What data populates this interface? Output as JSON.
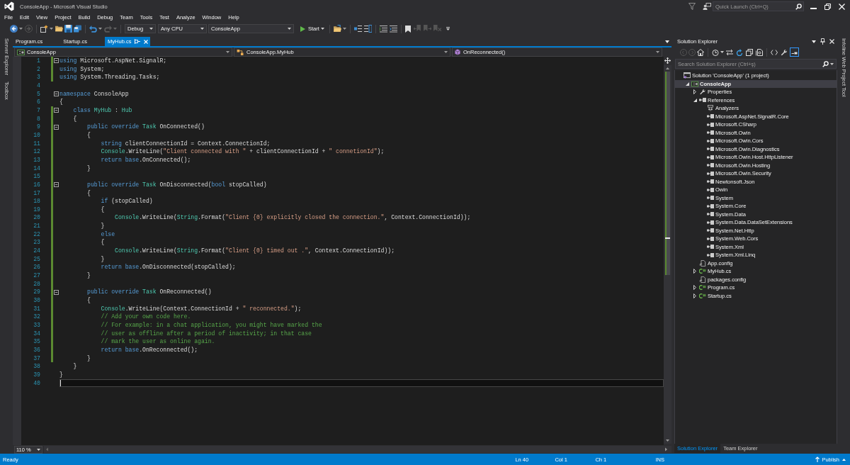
{
  "window": {
    "title": "ConsoleApp - Microsoft Visual Studio",
    "quick_launch": {
      "placeholder": "Quick Launch (Ctrl+Q)"
    }
  },
  "menu": [
    "File",
    "Edit",
    "View",
    "Project",
    "Build",
    "Debug",
    "Team",
    "Tools",
    "Test",
    "Analyze",
    "Window",
    "Help"
  ],
  "toolbar": {
    "configuration": "Debug",
    "platform": "Any CPU",
    "startup_project": "ConsoleApp",
    "run_button": "Start"
  },
  "left_tool_tabs": [
    "Server Explorer",
    "Toolbox"
  ],
  "document_tabs": [
    {
      "label": "Program.cs",
      "selected": false
    },
    {
      "label": "Startup.cs",
      "selected": false
    },
    {
      "label": "MyHub.cs",
      "selected": true
    }
  ],
  "navigation_bar": {
    "project": "ConsoleApp",
    "type": "ConsoleApp.MyHub",
    "member": "OnReconnected()"
  },
  "editor": {
    "lines": [
      {
        "number": "1",
        "changed": true,
        "collapsible": true,
        "current": false,
        "tokens": [
          {
            "kind": "keyword",
            "text": "using"
          },
          {
            "kind": "plain",
            "text": " Microsoft.AspNet.SignalR;"
          }
        ]
      },
      {
        "number": "2",
        "changed": true,
        "collapsible": false,
        "current": false,
        "tokens": [
          {
            "kind": "keyword",
            "text": "using"
          },
          {
            "kind": "plain",
            "text": " System;"
          }
        ]
      },
      {
        "number": "3",
        "changed": true,
        "collapsible": false,
        "current": false,
        "tokens": [
          {
            "kind": "keyword",
            "text": "using"
          },
          {
            "kind": "plain",
            "text": " System.Threading.Tasks;"
          }
        ]
      },
      {
        "number": "4",
        "changed": false,
        "collapsible": false,
        "current": false
      },
      {
        "number": "5",
        "changed": false,
        "collapsible": true,
        "current": false,
        "tokens": [
          {
            "kind": "keyword",
            "text": "namespace"
          },
          {
            "kind": "plain",
            "text": " ConsoleApp"
          }
        ]
      },
      {
        "number": "6",
        "changed": false,
        "collapsible": false,
        "current": false,
        "tokens": [
          {
            "kind": "plain",
            "text": "{"
          }
        ]
      },
      {
        "number": "7",
        "changed": true,
        "collapsible": true,
        "current": false,
        "tokens": [
          {
            "kind": "keyword",
            "text": "    class"
          },
          {
            "kind": "type",
            "text": " MyHub"
          },
          {
            "kind": "plain",
            "text": " : "
          },
          {
            "kind": "type",
            "text": "Hub"
          }
        ]
      },
      {
        "number": "8",
        "changed": true,
        "collapsible": false,
        "current": false,
        "tokens": [
          {
            "kind": "plain",
            "text": "    {"
          }
        ]
      },
      {
        "number": "9",
        "changed": true,
        "collapsible": true,
        "current": false,
        "tokens": [
          {
            "kind": "keyword",
            "text": "        public"
          },
          {
            "kind": "keyword",
            "text": " override"
          },
          {
            "kind": "type",
            "text": " Task"
          },
          {
            "kind": "plain",
            "text": " OnConnected()"
          }
        ]
      },
      {
        "number": "10",
        "changed": true,
        "collapsible": false,
        "current": false,
        "tokens": [
          {
            "kind": "plain",
            "text": "        {"
          }
        ]
      },
      {
        "number": "11",
        "changed": true,
        "collapsible": false,
        "current": false,
        "tokens": [
          {
            "kind": "keyword",
            "text": "            string"
          },
          {
            "kind": "plain",
            "text": " clientConnectionId = Context.ConnectionId;"
          }
        ]
      },
      {
        "number": "12",
        "changed": true,
        "collapsible": false,
        "current": false,
        "tokens": [
          {
            "kind": "type",
            "text": "            Console"
          },
          {
            "kind": "plain",
            "text": ".WriteLine("
          },
          {
            "kind": "string",
            "text": "\"Client connected with \""
          },
          {
            "kind": "plain",
            "text": " + clientConnectionId + "
          },
          {
            "kind": "string",
            "text": "\" connetionId\""
          },
          {
            "kind": "plain",
            "text": ");"
          }
        ]
      },
      {
        "number": "13",
        "changed": true,
        "collapsible": false,
        "current": false,
        "tokens": [
          {
            "kind": "keyword",
            "text": "            return"
          },
          {
            "kind": "keyword",
            "text": " base"
          },
          {
            "kind": "plain",
            "text": ".OnConnected();"
          }
        ]
      },
      {
        "number": "14",
        "changed": true,
        "collapsible": false,
        "current": false,
        "tokens": [
          {
            "kind": "plain",
            "text": "        }"
          }
        ]
      },
      {
        "number": "15",
        "changed": true,
        "collapsible": false,
        "current": false
      },
      {
        "number": "16",
        "changed": true,
        "collapsible": true,
        "current": false,
        "tokens": [
          {
            "kind": "keyword",
            "text": "        public"
          },
          {
            "kind": "keyword",
            "text": " override"
          },
          {
            "kind": "type",
            "text": " Task"
          },
          {
            "kind": "plain",
            "text": " OnDisconnected("
          },
          {
            "kind": "keyword",
            "text": "bool"
          },
          {
            "kind": "plain",
            "text": " stopCalled)"
          }
        ]
      },
      {
        "number": "17",
        "changed": true,
        "collapsible": false,
        "current": false,
        "tokens": [
          {
            "kind": "plain",
            "text": "        {"
          }
        ]
      },
      {
        "number": "18",
        "changed": true,
        "collapsible": false,
        "current": false,
        "tokens": [
          {
            "kind": "keyword",
            "text": "            if"
          },
          {
            "kind": "plain",
            "text": " (stopCalled)"
          }
        ]
      },
      {
        "number": "19",
        "changed": true,
        "collapsible": false,
        "current": false,
        "tokens": [
          {
            "kind": "plain",
            "text": "            {"
          }
        ]
      },
      {
        "number": "20",
        "changed": true,
        "collapsible": false,
        "current": false,
        "tokens": [
          {
            "kind": "type",
            "text": "                Console"
          },
          {
            "kind": "plain",
            "text": ".WriteLine("
          },
          {
            "kind": "type",
            "text": "String"
          },
          {
            "kind": "plain",
            "text": ".Format("
          },
          {
            "kind": "string",
            "text": "\"Client {0} explicitly closed the connection.\""
          },
          {
            "kind": "plain",
            "text": ", Context.ConnectionId));"
          }
        ]
      },
      {
        "number": "21",
        "changed": true,
        "collapsible": false,
        "current": false,
        "tokens": [
          {
            "kind": "plain",
            "text": "            }"
          }
        ]
      },
      {
        "number": "22",
        "changed": true,
        "collapsible": false,
        "current": false,
        "tokens": [
          {
            "kind": "keyword",
            "text": "            else"
          }
        ]
      },
      {
        "number": "23",
        "changed": true,
        "collapsible": false,
        "current": false,
        "tokens": [
          {
            "kind": "plain",
            "text": "            {"
          }
        ]
      },
      {
        "number": "24",
        "changed": true,
        "collapsible": false,
        "current": false,
        "tokens": [
          {
            "kind": "type",
            "text": "                Console"
          },
          {
            "kind": "plain",
            "text": ".WriteLine("
          },
          {
            "kind": "type",
            "text": "String"
          },
          {
            "kind": "plain",
            "text": ".Format("
          },
          {
            "kind": "string",
            "text": "\"Client {0} timed out .\""
          },
          {
            "kind": "plain",
            "text": ", Context.ConnectionId));"
          }
        ]
      },
      {
        "number": "25",
        "changed": true,
        "collapsible": false,
        "current": false,
        "tokens": [
          {
            "kind": "plain",
            "text": "            }"
          }
        ]
      },
      {
        "number": "26",
        "changed": true,
        "collapsible": false,
        "current": false,
        "tokens": [
          {
            "kind": "keyword",
            "text": "            return"
          },
          {
            "kind": "keyword",
            "text": " base"
          },
          {
            "kind": "plain",
            "text": ".OnDisconnected(stopCalled);"
          }
        ]
      },
      {
        "number": "27",
        "changed": true,
        "collapsible": false,
        "current": false,
        "tokens": [
          {
            "kind": "plain",
            "text": "        }"
          }
        ]
      },
      {
        "number": "28",
        "changed": true,
        "collapsible": false,
        "current": false
      },
      {
        "number": "29",
        "changed": true,
        "collapsible": true,
        "current": false,
        "tokens": [
          {
            "kind": "keyword",
            "text": "        public"
          },
          {
            "kind": "keyword",
            "text": " override"
          },
          {
            "kind": "type",
            "text": " Task"
          },
          {
            "kind": "plain",
            "text": " OnReconnected()"
          }
        ]
      },
      {
        "number": "30",
        "changed": true,
        "collapsible": false,
        "current": false,
        "tokens": [
          {
            "kind": "plain",
            "text": "        {"
          }
        ]
      },
      {
        "number": "31",
        "changed": true,
        "collapsible": false,
        "current": false,
        "tokens": [
          {
            "kind": "type",
            "text": "            Console"
          },
          {
            "kind": "plain",
            "text": ".WriteLine(Context.ConnectionId + "
          },
          {
            "kind": "string",
            "text": "\" reconnected.\""
          },
          {
            "kind": "plain",
            "text": ");"
          }
        ]
      },
      {
        "number": "32",
        "changed": true,
        "collapsible": false,
        "current": false,
        "tokens": [
          {
            "kind": "comment",
            "text": "            // Add your own code here."
          }
        ]
      },
      {
        "number": "33",
        "changed": true,
        "collapsible": false,
        "current": false,
        "tokens": [
          {
            "kind": "comment",
            "text": "            // For example: in a chat application, you might have marked the"
          }
        ]
      },
      {
        "number": "34",
        "changed": true,
        "collapsible": false,
        "current": false,
        "tokens": [
          {
            "kind": "comment",
            "text": "            // user as offline after a period of inactivity; in that case"
          }
        ]
      },
      {
        "number": "35",
        "changed": true,
        "collapsible": false,
        "current": false,
        "tokens": [
          {
            "kind": "comment",
            "text": "            // mark the user as online again."
          }
        ]
      },
      {
        "number": "36",
        "changed": true,
        "collapsible": false,
        "current": false,
        "tokens": [
          {
            "kind": "keyword",
            "text": "            return"
          },
          {
            "kind": "keyword",
            "text": " base"
          },
          {
            "kind": "plain",
            "text": ".OnReconnected();"
          }
        ]
      },
      {
        "number": "37",
        "changed": true,
        "collapsible": false,
        "current": false,
        "tokens": [
          {
            "kind": "plain",
            "text": "        }"
          }
        ]
      },
      {
        "number": "38",
        "changed": false,
        "collapsible": false,
        "current": false,
        "tokens": [
          {
            "kind": "plain",
            "text": "    }"
          }
        ]
      },
      {
        "number": "39",
        "changed": false,
        "collapsible": false,
        "current": false,
        "tokens": [
          {
            "kind": "plain",
            "text": "}"
          }
        ]
      },
      {
        "number": "40",
        "changed": false,
        "collapsible": false,
        "current": true
      }
    ],
    "zoom": "110 %"
  },
  "solution_explorer": {
    "title": "Solution Explorer",
    "preview_button": {
      "on": true
    },
    "search": {
      "placeholder": "Search Solution Explorer (Ctrl+ş)"
    },
    "tree": [
      {
        "label": "Solution 'ConsoleApp' (1 project)",
        "kind": "solution",
        "selected": false,
        "children": [
          {
            "label": "ConsoleApp",
            "kind": "project",
            "expanded": true,
            "selected": true,
            "children": [
              {
                "label": "Properties",
                "kind": "properties",
                "expanded": false,
                "selected": false
              },
              {
                "label": "References",
                "kind": "references",
                "expanded": true,
                "selected": false,
                "children": [
                  {
                    "label": "Analyzers",
                    "kind": "analyzers",
                    "selected": false
                  },
                  {
                    "label": "Microsoft.AspNet.SignalR.Core",
                    "kind": "reference",
                    "selected": false
                  },
                  {
                    "label": "Microsoft.CSharp",
                    "kind": "reference",
                    "selected": false
                  },
                  {
                    "label": "Microsoft.Owin",
                    "kind": "reference",
                    "selected": false
                  },
                  {
                    "label": "Microsoft.Owin.Cors",
                    "kind": "reference",
                    "selected": false
                  },
                  {
                    "label": "Microsoft.Owin.Diagnostics",
                    "kind": "reference",
                    "selected": false
                  },
                  {
                    "label": "Microsoft.Owin.Host.HttpListener",
                    "kind": "reference",
                    "selected": false
                  },
                  {
                    "label": "Microsoft.Owin.Hosting",
                    "kind": "reference",
                    "selected": false
                  },
                  {
                    "label": "Microsoft.Owin.Security",
                    "kind": "reference",
                    "selected": false
                  },
                  {
                    "label": "Newtonsoft.Json",
                    "kind": "reference",
                    "selected": false
                  },
                  {
                    "label": "Owin",
                    "kind": "reference",
                    "selected": false
                  },
                  {
                    "label": "System",
                    "kind": "reference",
                    "selected": false
                  },
                  {
                    "label": "System.Core",
                    "kind": "reference",
                    "selected": false
                  },
                  {
                    "label": "System.Data",
                    "kind": "reference",
                    "selected": false
                  },
                  {
                    "label": "System.Data.DataSetExtensions",
                    "kind": "reference",
                    "selected": false
                  },
                  {
                    "label": "System.Net.Http",
                    "kind": "reference",
                    "selected": false
                  },
                  {
                    "label": "System.Web.Cors",
                    "kind": "reference",
                    "selected": false
                  },
                  {
                    "label": "System.Xml",
                    "kind": "reference",
                    "selected": false
                  },
                  {
                    "label": "System.Xml.Linq",
                    "kind": "reference",
                    "selected": false
                  }
                ]
              },
              {
                "label": "App.config",
                "kind": "config",
                "selected": false
              },
              {
                "label": "MyHub.cs",
                "kind": "csharp",
                "expanded": false,
                "selected": false
              },
              {
                "label": "packages.config",
                "kind": "config",
                "selected": false
              },
              {
                "label": "Program.cs",
                "kind": "csharp",
                "expanded": false,
                "selected": false
              },
              {
                "label": "Startup.cs",
                "kind": "csharp",
                "expanded": false,
                "selected": false
              }
            ]
          }
        ]
      }
    ],
    "tabs": [
      {
        "label": "Solution Explorer",
        "selected": true
      },
      {
        "label": "Team Explorer",
        "selected": false
      }
    ]
  },
  "right_tool_tabs": [
    "Infoline Web Project Tool"
  ],
  "status_bar": {
    "message": "Ready",
    "line": "Ln 40",
    "column": "Col 1",
    "character": "Ch 1",
    "mode": "INS",
    "publish": "Publish"
  }
}
